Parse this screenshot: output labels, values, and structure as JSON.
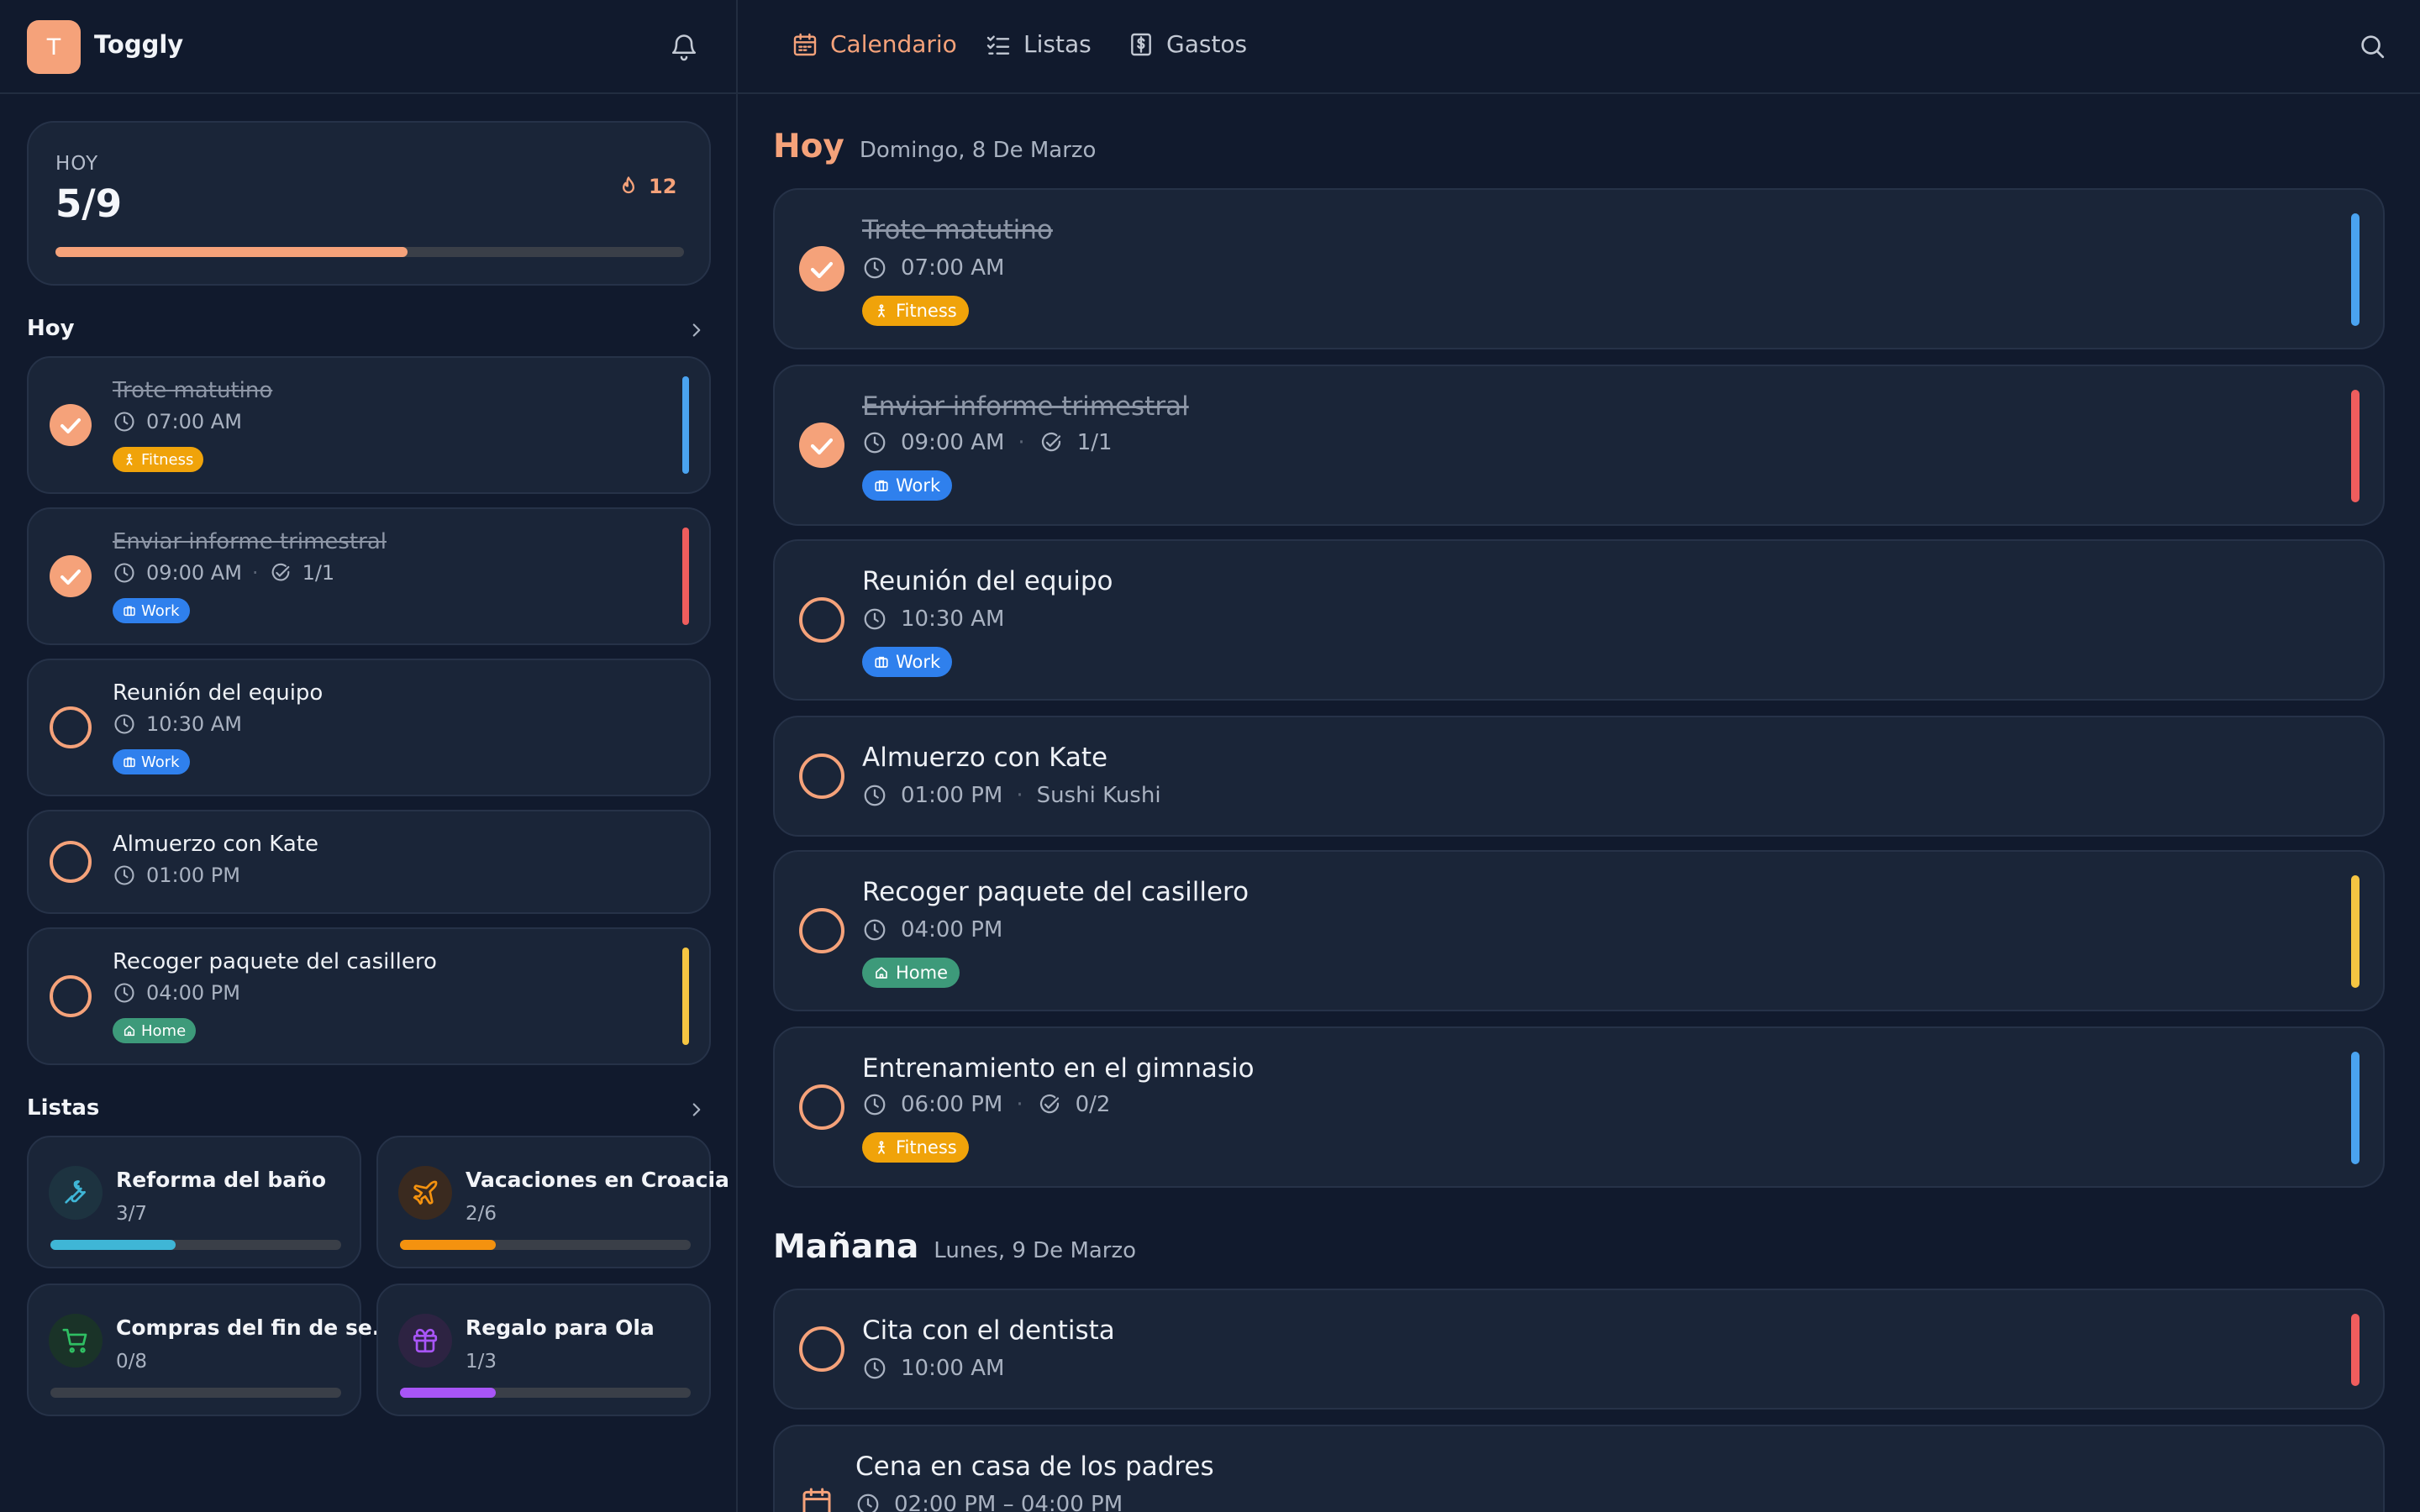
{
  "app": {
    "logo_letter": "T",
    "name": "Toggly"
  },
  "summary": {
    "label": "HOY",
    "count": "5/9",
    "streak": "12",
    "progress": 0.56
  },
  "sidebar": {
    "today_title": "Hoy",
    "lists_title": "Listas",
    "tasks": [
      {
        "title": "Trote matutino",
        "time": "07:00 AM",
        "done": true,
        "tag": "Fitness",
        "bar_color": "#4aa3f0"
      },
      {
        "title": "Enviar informe trimestral",
        "time": "09:00 AM",
        "subtasks": "1/1",
        "done": true,
        "tag": "Work",
        "bar_color": "#ef5d5d"
      },
      {
        "title": "Reunión del equipo",
        "time": "10:30 AM",
        "done": false,
        "tag": "Work"
      },
      {
        "title": "Almuerzo con Kate",
        "time": "01:00 PM",
        "done": false
      },
      {
        "title": "Recoger paquete del casillero",
        "time": "04:00 PM",
        "done": false,
        "tag": "Home",
        "bar_color": "#f5c542"
      }
    ],
    "lists": [
      {
        "name": "Reforma del baño",
        "count": "3/7",
        "progress": 0.43,
        "color": "#3fb6d6",
        "icon": "wrench-icon"
      },
      {
        "name": "Vacaciones en Croacia",
        "count": "2/6",
        "progress": 0.33,
        "color": "#f4920f",
        "icon": "plane-icon"
      },
      {
        "name": "Compras del fin de se...",
        "count": "0/8",
        "progress": 0.0,
        "color": "#2fbf63",
        "icon": "cart-icon"
      },
      {
        "name": "Regalo para Ola",
        "count": "1/3",
        "progress": 0.33,
        "color": "#a855f7",
        "icon": "gift-icon"
      }
    ]
  },
  "nav": {
    "tabs": [
      {
        "label": "Calendario",
        "icon": "calendar-icon",
        "active": true
      },
      {
        "label": "Listas",
        "icon": "checklist-icon",
        "active": false
      },
      {
        "label": "Gastos",
        "icon": "dollar-icon",
        "active": false
      }
    ]
  },
  "days": {
    "today": {
      "title": "Hoy",
      "date": "Domingo, 8 De Marzo",
      "tasks": [
        {
          "title": "Trote matutino",
          "time": "07:00 AM",
          "done": true,
          "tag": "Fitness",
          "bar_color": "#4aa3f0"
        },
        {
          "title": "Enviar informe trimestral",
          "time": "09:00 AM",
          "subtasks": "1/1",
          "done": true,
          "tag": "Work",
          "bar_color": "#ef5d5d"
        },
        {
          "title": "Reunión del equipo",
          "time": "10:30 AM",
          "done": false,
          "tag": "Work"
        },
        {
          "title": "Almuerzo con Kate",
          "time": "01:00 PM",
          "location": "Sushi Kushi",
          "done": false
        },
        {
          "title": "Recoger paquete del casillero",
          "time": "04:00 PM",
          "done": false,
          "tag": "Home",
          "bar_color": "#f5c542"
        },
        {
          "title": "Entrenamiento en el gimnasio",
          "time": "06:00 PM",
          "subtasks": "0/2",
          "done": false,
          "tag": "Fitness",
          "bar_color": "#4aa3f0"
        }
      ]
    },
    "tomorrow": {
      "title": "Mañana",
      "date": "Lunes, 9 De Marzo",
      "tasks": [
        {
          "title": "Cita con el dentista",
          "time": "10:00 AM",
          "done": false,
          "bar_color": "#ef5d5d"
        }
      ],
      "event": {
        "title": "Cena en casa de los padres",
        "time": "02:00 PM – 04:00 PM"
      }
    }
  },
  "colors": {
    "accent": "#f5a27a",
    "background": "#111a2d",
    "card": "#1a2538"
  }
}
